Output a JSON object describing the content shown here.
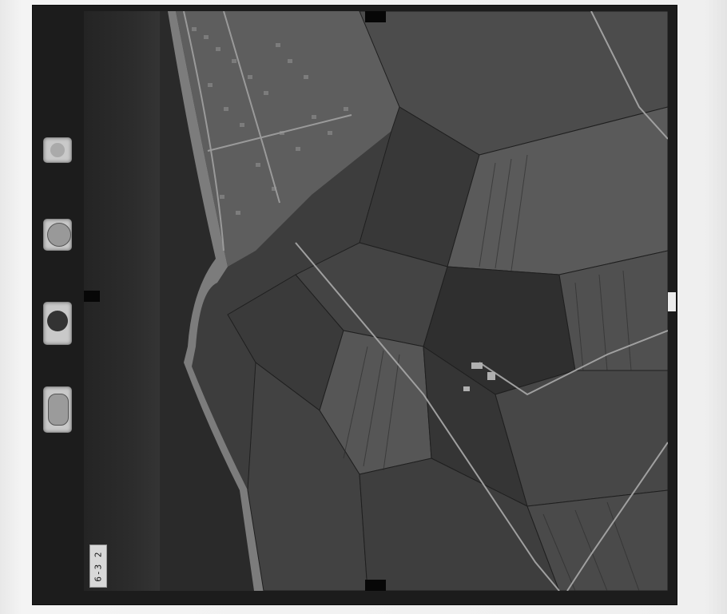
{
  "image": {
    "kind": "black-and-white aerial survey photograph",
    "frame_number": "6-3 2",
    "colors": {
      "sea": "#2a2a2a",
      "frame": "#1c1c1c",
      "fields": "#4a4a4a",
      "paper": "#ececec"
    }
  },
  "instruments": [
    {
      "icon": "altimeter-icon"
    },
    {
      "icon": "clock-icon"
    },
    {
      "icon": "level-bubble-icon"
    },
    {
      "icon": "counter-dial-icon"
    }
  ]
}
